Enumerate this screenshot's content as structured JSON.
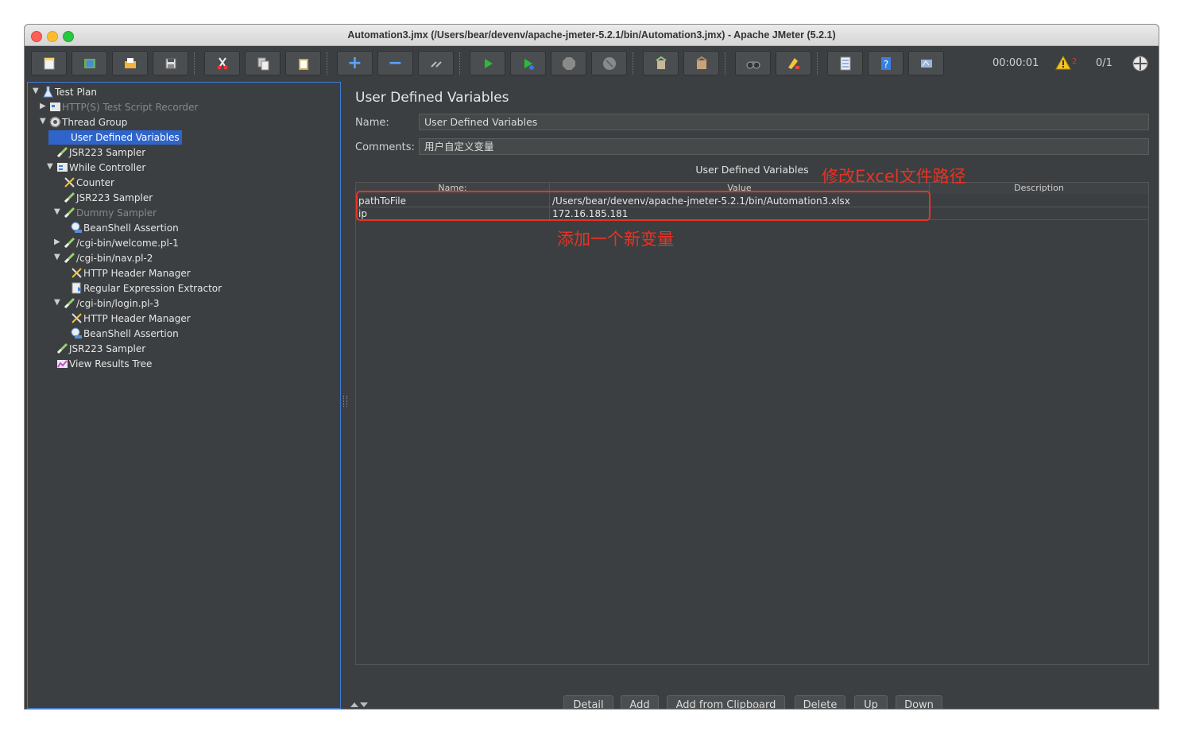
{
  "window": {
    "title": "Automation3.jmx (/Users/bear/devenv/apache-jmeter-5.2.1/bin/Automation3.jmx) - Apache JMeter (5.2.1)"
  },
  "toolbar": {
    "buttons": [
      "new-icon",
      "templates-icon",
      "open-icon",
      "save-icon",
      "cut-icon",
      "copy-icon",
      "paste-icon",
      "expand-icon",
      "collapse-icon",
      "toggle-icon",
      "start-icon",
      "start-no-pause-icon",
      "stop-icon",
      "shutdown-icon",
      "clear-icon",
      "clear-all-icon",
      "search-icon",
      "reset-search-icon",
      "function-helper-icon",
      "help-icon",
      "remote-icon"
    ],
    "timer": "00:00:01",
    "warning_count": "2",
    "threads": "0/1"
  },
  "tree": [
    {
      "label": "Test Plan",
      "icon": "test-plan-icon",
      "arrow": "▼",
      "indent": 0,
      "dim": false,
      "sel": false
    },
    {
      "label": "HTTP(S) Test Script Recorder",
      "icon": "recorder-icon",
      "arrow": "▶",
      "indent": 1,
      "dim": true,
      "sel": false
    },
    {
      "label": "Thread Group",
      "icon": "gear-icon",
      "arrow": "▼",
      "indent": 1,
      "dim": false,
      "sel": false
    },
    {
      "label": "User Defined Variables",
      "icon": "config-wrench-icon",
      "arrow": "",
      "indent": 2,
      "dim": false,
      "sel": true
    },
    {
      "label": "JSR223 Sampler",
      "icon": "sampler-icon",
      "arrow": "",
      "indent": 2,
      "dim": false,
      "sel": false
    },
    {
      "label": "While Controller",
      "icon": "controller-icon",
      "arrow": "▼",
      "indent": 2,
      "dim": false,
      "sel": false
    },
    {
      "label": "Counter",
      "icon": "config-wrench-icon",
      "arrow": "",
      "indent": 3,
      "dim": false,
      "sel": false
    },
    {
      "label": "JSR223 Sampler",
      "icon": "sampler-icon",
      "arrow": "",
      "indent": 3,
      "dim": false,
      "sel": false
    },
    {
      "label": "Dummy Sampler",
      "icon": "sampler-icon",
      "arrow": "▼",
      "indent": 3,
      "dim": true,
      "sel": false
    },
    {
      "label": "BeanShell Assertion",
      "icon": "assertion-icon",
      "arrow": "",
      "indent": 4,
      "dim": false,
      "sel": false
    },
    {
      "label": "/cgi-bin/welcome.pl-1",
      "icon": "sampler-icon",
      "arrow": "▶",
      "indent": 3,
      "dim": false,
      "sel": false
    },
    {
      "label": "/cgi-bin/nav.pl-2",
      "icon": "sampler-icon",
      "arrow": "▼",
      "indent": 3,
      "dim": false,
      "sel": false
    },
    {
      "label": "HTTP Header Manager",
      "icon": "config-wrench-icon",
      "arrow": "",
      "indent": 4,
      "dim": false,
      "sel": false
    },
    {
      "label": "Regular Expression Extractor",
      "icon": "extractor-icon",
      "arrow": "",
      "indent": 4,
      "dim": false,
      "sel": false
    },
    {
      "label": "/cgi-bin/login.pl-3",
      "icon": "sampler-icon",
      "arrow": "▼",
      "indent": 3,
      "dim": false,
      "sel": false
    },
    {
      "label": "HTTP Header Manager",
      "icon": "config-wrench-icon",
      "arrow": "",
      "indent": 4,
      "dim": false,
      "sel": false
    },
    {
      "label": "BeanShell Assertion",
      "icon": "assertion-icon",
      "arrow": "",
      "indent": 4,
      "dim": false,
      "sel": false
    },
    {
      "label": "JSR223 Sampler",
      "icon": "sampler-icon",
      "arrow": "",
      "indent": 2,
      "dim": false,
      "sel": false
    },
    {
      "label": "View Results Tree",
      "icon": "listener-icon",
      "arrow": "",
      "indent": 2,
      "dim": false,
      "sel": false
    }
  ],
  "panel": {
    "heading": "User Defined Variables",
    "name_label": "Name:",
    "name_value": "User Defined Variables",
    "comments_label": "Comments:",
    "comments_value": "用户自定义变量",
    "table_title": "User Defined Variables",
    "columns": [
      "Name:",
      "Value",
      "Description"
    ],
    "rows": [
      {
        "name": "pathToFile",
        "value": "/Users/bear/devenv/apache-jmeter-5.2.1/bin/Automation3.xlsx",
        "description": ""
      },
      {
        "name": "ip",
        "value": "172.16.185.181",
        "description": ""
      }
    ],
    "buttons": [
      "Detail",
      "Add",
      "Add from Clipboard",
      "Delete",
      "Up",
      "Down"
    ]
  },
  "annotations": {
    "edit_path": "修改Excel文件路径",
    "add_var": "添加一个新变量",
    "color": "#e83324"
  },
  "colors": {
    "bg": "#3c3f41",
    "selection": "#2f65ca",
    "focus_border": "#3d7ad6"
  }
}
